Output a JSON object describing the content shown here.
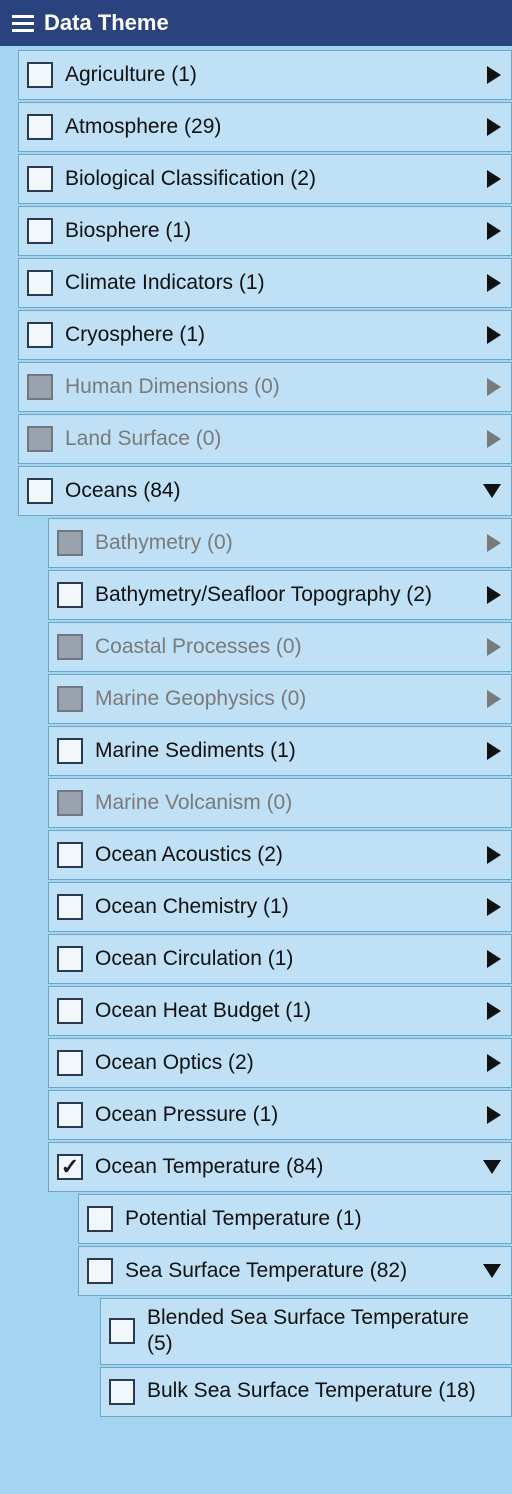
{
  "header": {
    "title": "Data Theme"
  },
  "rows": [
    {
      "depth": 0,
      "label": "Agriculture",
      "count": 1,
      "disabled": false,
      "checked": false,
      "arrow": "right"
    },
    {
      "depth": 0,
      "label": "Atmosphere",
      "count": 29,
      "disabled": false,
      "checked": false,
      "arrow": "right"
    },
    {
      "depth": 0,
      "label": "Biological Classification",
      "count": 2,
      "disabled": false,
      "checked": false,
      "arrow": "right"
    },
    {
      "depth": 0,
      "label": "Biosphere",
      "count": 1,
      "disabled": false,
      "checked": false,
      "arrow": "right"
    },
    {
      "depth": 0,
      "label": "Climate Indicators",
      "count": 1,
      "disabled": false,
      "checked": false,
      "arrow": "right"
    },
    {
      "depth": 0,
      "label": "Cryosphere",
      "count": 1,
      "disabled": false,
      "checked": false,
      "arrow": "right"
    },
    {
      "depth": 0,
      "label": "Human Dimensions",
      "count": 0,
      "disabled": true,
      "checked": false,
      "arrow": "right"
    },
    {
      "depth": 0,
      "label": "Land Surface",
      "count": 0,
      "disabled": true,
      "checked": false,
      "arrow": "right"
    },
    {
      "depth": 0,
      "label": "Oceans",
      "count": 84,
      "disabled": false,
      "checked": false,
      "arrow": "down"
    },
    {
      "depth": 1,
      "label": "Bathymetry",
      "count": 0,
      "disabled": true,
      "checked": false,
      "arrow": "right"
    },
    {
      "depth": 1,
      "label": "Bathymetry/Seafloor Topography",
      "count": 2,
      "disabled": false,
      "checked": false,
      "arrow": "right"
    },
    {
      "depth": 1,
      "label": "Coastal Processes",
      "count": 0,
      "disabled": true,
      "checked": false,
      "arrow": "right"
    },
    {
      "depth": 1,
      "label": "Marine Geophysics",
      "count": 0,
      "disabled": true,
      "checked": false,
      "arrow": "right"
    },
    {
      "depth": 1,
      "label": "Marine Sediments",
      "count": 1,
      "disabled": false,
      "checked": false,
      "arrow": "right"
    },
    {
      "depth": 1,
      "label": "Marine Volcanism",
      "count": 0,
      "disabled": true,
      "checked": false,
      "arrow": "none"
    },
    {
      "depth": 1,
      "label": "Ocean Acoustics",
      "count": 2,
      "disabled": false,
      "checked": false,
      "arrow": "right"
    },
    {
      "depth": 1,
      "label": "Ocean Chemistry",
      "count": 1,
      "disabled": false,
      "checked": false,
      "arrow": "right"
    },
    {
      "depth": 1,
      "label": "Ocean Circulation",
      "count": 1,
      "disabled": false,
      "checked": false,
      "arrow": "right"
    },
    {
      "depth": 1,
      "label": "Ocean Heat Budget",
      "count": 1,
      "disabled": false,
      "checked": false,
      "arrow": "right"
    },
    {
      "depth": 1,
      "label": "Ocean Optics",
      "count": 2,
      "disabled": false,
      "checked": false,
      "arrow": "right"
    },
    {
      "depth": 1,
      "label": "Ocean Pressure",
      "count": 1,
      "disabled": false,
      "checked": false,
      "arrow": "right"
    },
    {
      "depth": 1,
      "label": "Ocean Temperature",
      "count": 84,
      "disabled": false,
      "checked": true,
      "arrow": "down"
    },
    {
      "depth": 2,
      "label": "Potential Temperature",
      "count": 1,
      "disabled": false,
      "checked": false,
      "arrow": "none"
    },
    {
      "depth": 2,
      "label": "Sea Surface Temperature",
      "count": 82,
      "disabled": false,
      "checked": false,
      "arrow": "down"
    },
    {
      "depth": 3,
      "label": "Blended Sea Surface Temperature",
      "count": 5,
      "disabled": false,
      "checked": false,
      "arrow": "none"
    },
    {
      "depth": 3,
      "label": "Bulk Sea Surface Temperature",
      "count": 18,
      "disabled": false,
      "checked": false,
      "arrow": "none"
    }
  ]
}
